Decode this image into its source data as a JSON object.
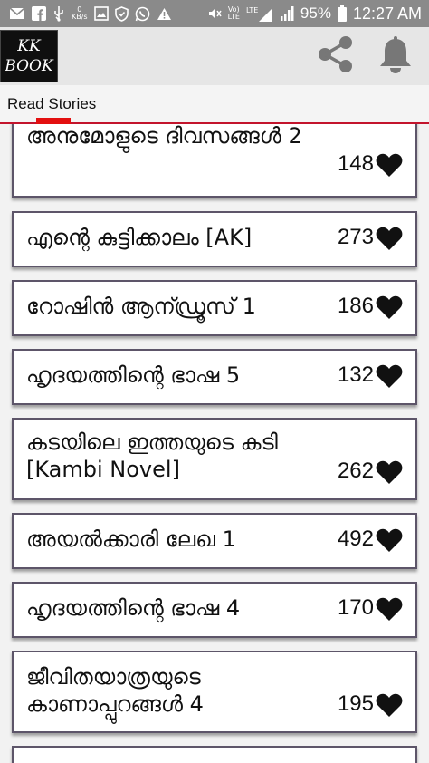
{
  "status_bar": {
    "battery": "95%",
    "time": "12:27 AM",
    "kbs_top": "0",
    "kbs_bottom": "KB/s",
    "lte_top": "Vo)",
    "lte_bottom": "LTE"
  },
  "app_bar": {
    "logo_line1": "KK",
    "logo_line2": "BOOK"
  },
  "tabs": [
    {
      "label": "Read Stories",
      "selected": true
    }
  ],
  "stories": [
    {
      "title": "അനുമോളുടെ ദിവസങ്ങൾ 2",
      "likes": "148"
    },
    {
      "title": "എന്റെ കുട്ടിക്കാലം [AK]",
      "likes": "273"
    },
    {
      "title": "റോഷിൻ ആന്ഡ്രൂസ് 1",
      "likes": "186"
    },
    {
      "title": "ഹൃദയത്തിന്റെ ഭാഷ 5",
      "likes": "132"
    },
    {
      "title": "കടയിലെ ഇത്തയുടെ കടി [Kambi Novel]",
      "likes": "262"
    },
    {
      "title": "അയൽക്കാരി ലേഖ 1",
      "likes": "492"
    },
    {
      "title": "ഹൃദയത്തിന്റെ ഭാഷ 4",
      "likes": "170"
    },
    {
      "title": "ജീവിതയാത്രയുടെ കാണാപ്പുറങ്ങൾ 4",
      "likes": "195"
    }
  ],
  "colors": {
    "status_bar": "#8a8a8a",
    "app_bar": "#e6e6e6",
    "tab_indicator": "#e31010",
    "card_border": "#5d5569"
  }
}
